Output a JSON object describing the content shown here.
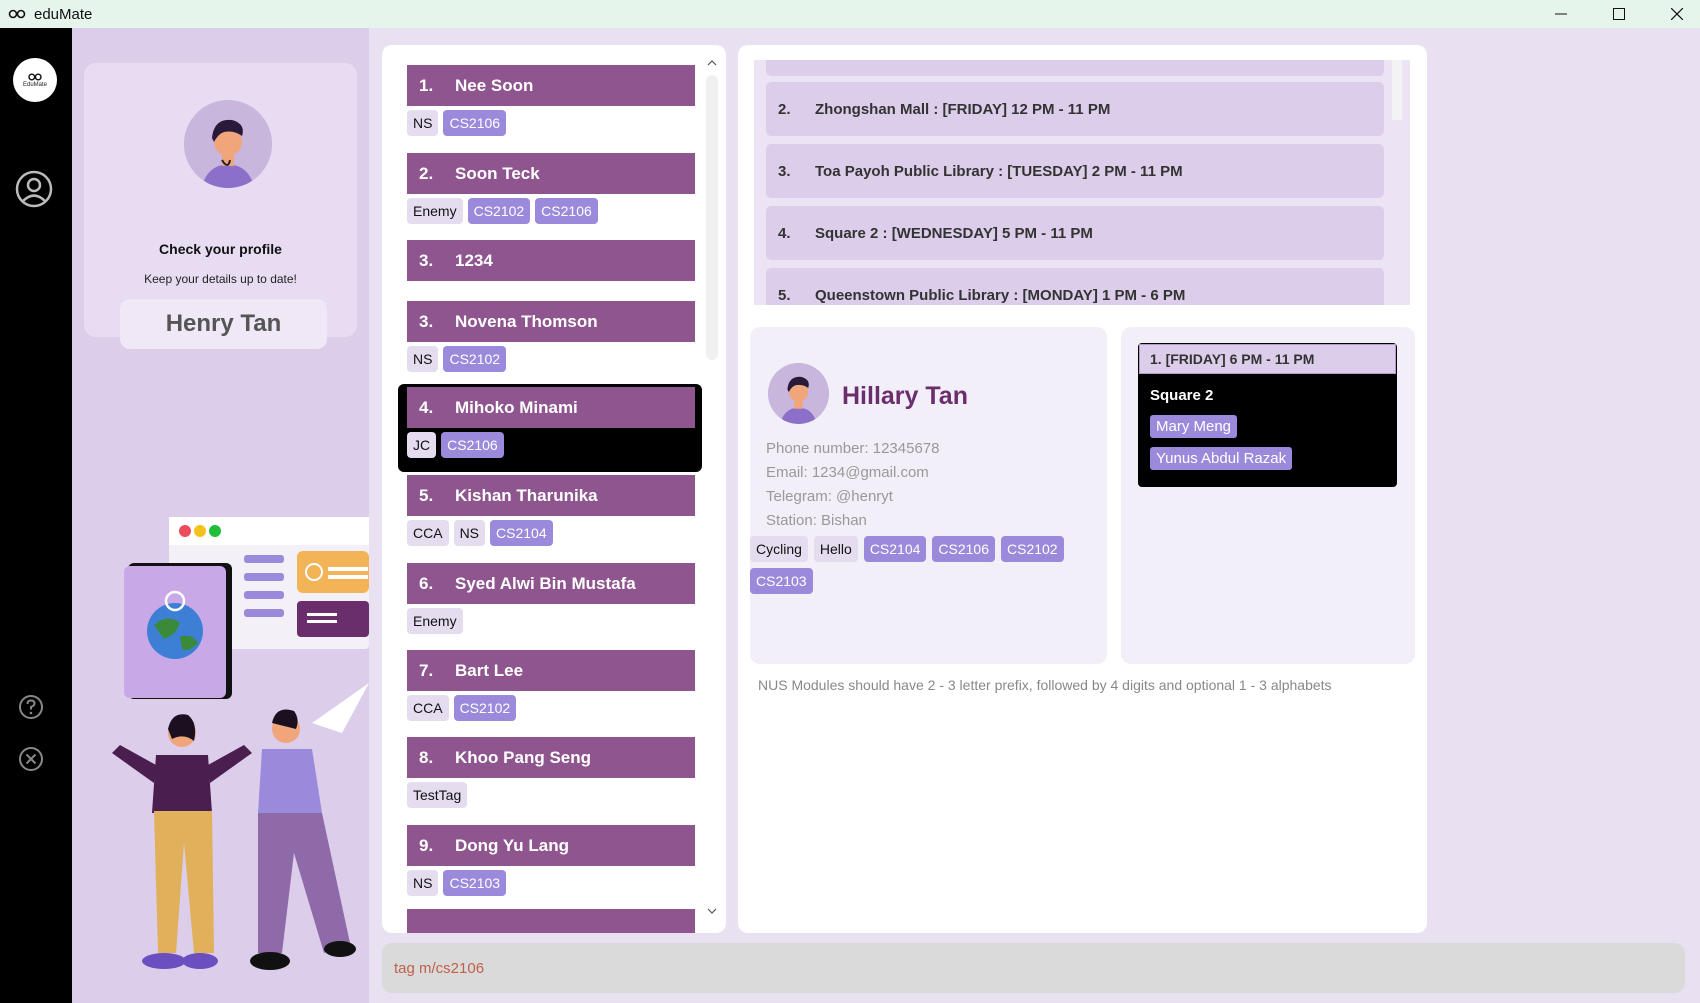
{
  "app": {
    "title": "eduMate",
    "logo_text": "EduMate"
  },
  "profile": {
    "check_title": "Check your profile",
    "check_subtitle": "Keep your details up to date!",
    "name": "Henry Tan"
  },
  "contacts": [
    {
      "index": "1.",
      "name": "Nee Soon",
      "tags": [
        {
          "label": "NS",
          "module": false
        },
        {
          "label": "CS2106",
          "module": true
        }
      ]
    },
    {
      "index": "2.",
      "name": "Soon Teck",
      "tags": [
        {
          "label": "Enemy",
          "module": false
        },
        {
          "label": "CS2102",
          "module": true
        },
        {
          "label": "CS2106",
          "module": true
        }
      ]
    },
    {
      "index": "3.",
      "name": "1234",
      "tags": []
    },
    {
      "index": "3.",
      "name": "Novena Thomson",
      "tags": [
        {
          "label": "NS",
          "module": false
        },
        {
          "label": "CS2102",
          "module": true
        }
      ]
    },
    {
      "index": "4.",
      "name": "Mihoko Minami",
      "tags": [
        {
          "label": "JC",
          "module": false
        },
        {
          "label": "CS2106",
          "module": true
        }
      ]
    },
    {
      "index": "5.",
      "name": "Kishan Tharunika",
      "tags": [
        {
          "label": "CCA",
          "module": false
        },
        {
          "label": "NS",
          "module": false
        },
        {
          "label": "CS2104",
          "module": true
        }
      ]
    },
    {
      "index": "6.",
      "name": "Syed Alwi Bin Mustafa",
      "tags": [
        {
          "label": "Enemy",
          "module": false
        }
      ]
    },
    {
      "index": "7.",
      "name": "Bart Lee",
      "tags": [
        {
          "label": "CCA",
          "module": false
        },
        {
          "label": "CS2102",
          "module": true
        }
      ]
    },
    {
      "index": "8.",
      "name": "Khoo Pang Seng",
      "tags": [
        {
          "label": "TestTag",
          "module": false
        }
      ]
    },
    {
      "index": "9.",
      "name": "Dong Yu Lang",
      "tags": [
        {
          "label": "NS",
          "module": false
        },
        {
          "label": "CS2103",
          "module": true
        }
      ]
    }
  ],
  "study_spots": [
    {
      "index": "2.",
      "text": "Zhongshan Mall : [FRIDAY] 12 PM - 11 PM"
    },
    {
      "index": "3.",
      "text": "Toa Payoh Public Library : [TUESDAY] 2 PM - 11 PM"
    },
    {
      "index": "4.",
      "text": "Square 2 : [WEDNESDAY] 5 PM - 11 PM"
    },
    {
      "index": "5.",
      "text": "Queenstown Public Library : [MONDAY] 1 PM - 6 PM"
    }
  ],
  "person": {
    "name": "Hillary Tan",
    "phone": "Phone number: 12345678",
    "email": "Email: 1234@gmail.com",
    "telegram": "Telegram: @henryt",
    "station": "Station: Bishan",
    "tags": [
      {
        "label": "Cycling",
        "module": false
      },
      {
        "label": "Hello",
        "module": false
      },
      {
        "label": "CS2104",
        "module": true
      },
      {
        "label": "CS2106",
        "module": true
      },
      {
        "label": "CS2102",
        "module": true
      },
      {
        "label": "CS2103",
        "module": true
      }
    ]
  },
  "meetup": {
    "header": "1. [FRIDAY] 6 PM - 11 PM",
    "location": "Square 2",
    "people": [
      "Mary Meng",
      "Yunus Abdul Razak"
    ]
  },
  "feedback": "NUS Modules should have 2 - 3 letter prefix, followed by 4 digits and optional 1 - 3 alphabets",
  "command": {
    "value": "tag m/cs2106"
  },
  "colors": {
    "accent": "#8e558f",
    "module_tag": "#9b8adb",
    "tag": "#e6dcef",
    "panel": "#dccdea"
  }
}
